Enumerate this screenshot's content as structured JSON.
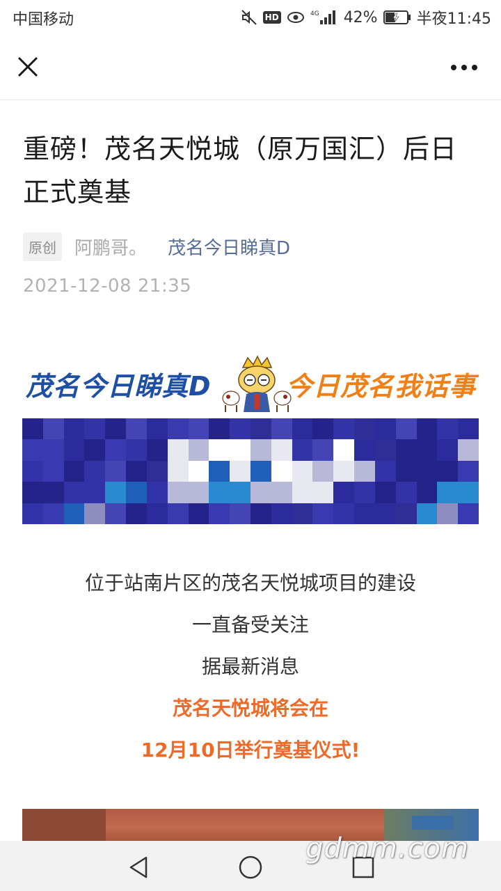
{
  "status_bar": {
    "carrier": "中国移动",
    "hd": "HD",
    "network": "4G",
    "battery": "42%",
    "battery_level": 0.42,
    "time": "半夜11:45"
  },
  "nav": {
    "close_icon": "close-icon",
    "more_icon": "more-icon"
  },
  "article": {
    "title": "重磅！茂名天悦城（原万国汇）后日正式奠基",
    "tag": "原创",
    "author": "阿鹏哥。",
    "account": "茂名今日睇真D",
    "publish_time": "2021-12-08 21:35"
  },
  "banner": {
    "left_text": "茂名今日睇真D",
    "right_text": "今日茂名我话事"
  },
  "body": {
    "lines": [
      "位于站南片区的茂名天悦城项目的建设",
      "一直备受关注",
      "据最新消息"
    ],
    "highlight_lines": [
      "茂名天悦城将会在",
      "12月10日举行奠基仪式!"
    ]
  },
  "colors": {
    "link": "#576b95",
    "highlight": "#ee6a28",
    "banner_blue": "#1f4fa3",
    "banner_orange": "#f07f16"
  },
  "watermark": "gdmm.com"
}
